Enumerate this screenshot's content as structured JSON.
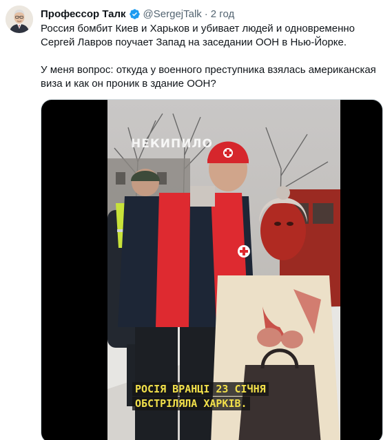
{
  "author": {
    "name": "Профессор Талк",
    "handle": "@SergejTalk",
    "separator": "·",
    "time": "2 год"
  },
  "tweet": {
    "paragraph_1": "Россия бомбит Киев и Харьков и убивает людей и одновременно Сергей Лавров поучает Запад на заседании ООН в Нью-Йорке.",
    "paragraph_2": "У меня вопрос: откуда у военного преступника взялась американская виза и как он проник в здание ООН?"
  },
  "media": {
    "watermark": "НЕКИПИЛО",
    "caption_line_1": "РОСІЯ ВРАНЦІ 23 СІЧНЯ",
    "caption_line_2": "ОБСТРІЛЯЛА ХАРКІВ."
  },
  "icons": {
    "verified": "verified-badge-icon",
    "avatar": "avatar"
  },
  "colors": {
    "verified_blue": "#1d9bf0",
    "secondary_text": "#536471",
    "caption_yellow": "#f2e04a",
    "red_cross_red": "#d9262c"
  }
}
